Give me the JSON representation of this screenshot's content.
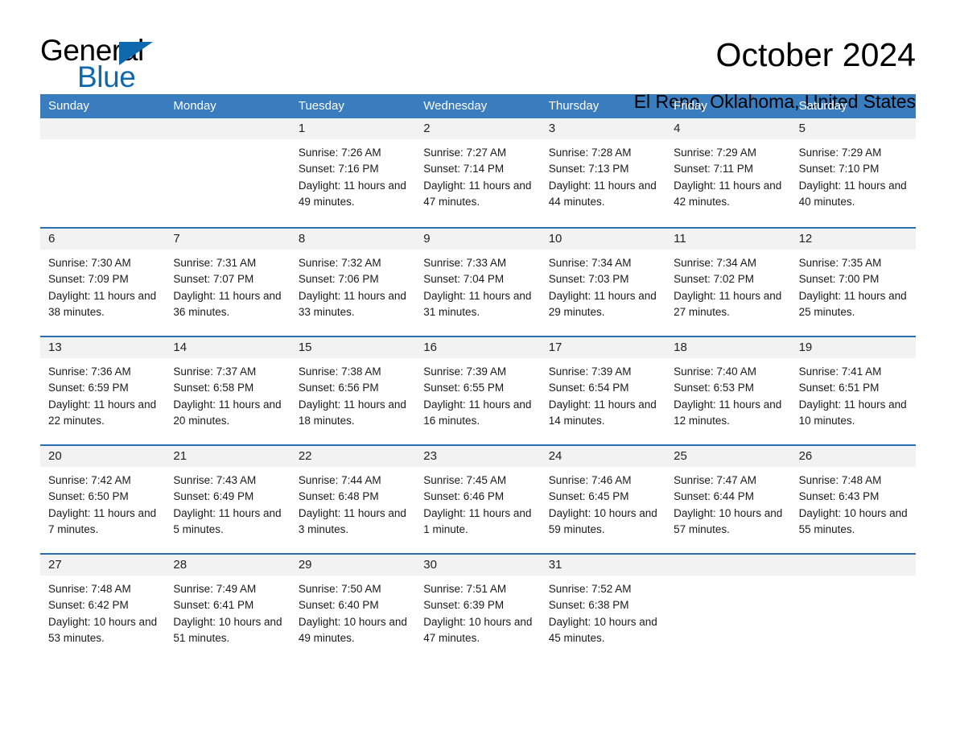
{
  "brand": {
    "word1": "General",
    "word2": "Blue",
    "accent_color": "#1068ad"
  },
  "header": {
    "title": "October 2024",
    "location": "El Reno, Oklahoma, United States"
  },
  "calendar": {
    "header_bg": "#3a7dbf",
    "row_border": "#2a6db3",
    "daynumber_bg": "#f2f2f2",
    "weekdays": [
      "Sunday",
      "Monday",
      "Tuesday",
      "Wednesday",
      "Thursday",
      "Friday",
      "Saturday"
    ],
    "weeks": [
      [
        {
          "day": "",
          "info": ""
        },
        {
          "day": "",
          "info": ""
        },
        {
          "day": "1",
          "info": "Sunrise: 7:26 AM\nSunset: 7:16 PM\nDaylight: 11 hours and 49 minutes."
        },
        {
          "day": "2",
          "info": "Sunrise: 7:27 AM\nSunset: 7:14 PM\nDaylight: 11 hours and 47 minutes."
        },
        {
          "day": "3",
          "info": "Sunrise: 7:28 AM\nSunset: 7:13 PM\nDaylight: 11 hours and 44 minutes."
        },
        {
          "day": "4",
          "info": "Sunrise: 7:29 AM\nSunset: 7:11 PM\nDaylight: 11 hours and 42 minutes."
        },
        {
          "day": "5",
          "info": "Sunrise: 7:29 AM\nSunset: 7:10 PM\nDaylight: 11 hours and 40 minutes."
        }
      ],
      [
        {
          "day": "6",
          "info": "Sunrise: 7:30 AM\nSunset: 7:09 PM\nDaylight: 11 hours and 38 minutes."
        },
        {
          "day": "7",
          "info": "Sunrise: 7:31 AM\nSunset: 7:07 PM\nDaylight: 11 hours and 36 minutes."
        },
        {
          "day": "8",
          "info": "Sunrise: 7:32 AM\nSunset: 7:06 PM\nDaylight: 11 hours and 33 minutes."
        },
        {
          "day": "9",
          "info": "Sunrise: 7:33 AM\nSunset: 7:04 PM\nDaylight: 11 hours and 31 minutes."
        },
        {
          "day": "10",
          "info": "Sunrise: 7:34 AM\nSunset: 7:03 PM\nDaylight: 11 hours and 29 minutes."
        },
        {
          "day": "11",
          "info": "Sunrise: 7:34 AM\nSunset: 7:02 PM\nDaylight: 11 hours and 27 minutes."
        },
        {
          "day": "12",
          "info": "Sunrise: 7:35 AM\nSunset: 7:00 PM\nDaylight: 11 hours and 25 minutes."
        }
      ],
      [
        {
          "day": "13",
          "info": "Sunrise: 7:36 AM\nSunset: 6:59 PM\nDaylight: 11 hours and 22 minutes."
        },
        {
          "day": "14",
          "info": "Sunrise: 7:37 AM\nSunset: 6:58 PM\nDaylight: 11 hours and 20 minutes."
        },
        {
          "day": "15",
          "info": "Sunrise: 7:38 AM\nSunset: 6:56 PM\nDaylight: 11 hours and 18 minutes."
        },
        {
          "day": "16",
          "info": "Sunrise: 7:39 AM\nSunset: 6:55 PM\nDaylight: 11 hours and 16 minutes."
        },
        {
          "day": "17",
          "info": "Sunrise: 7:39 AM\nSunset: 6:54 PM\nDaylight: 11 hours and 14 minutes."
        },
        {
          "day": "18",
          "info": "Sunrise: 7:40 AM\nSunset: 6:53 PM\nDaylight: 11 hours and 12 minutes."
        },
        {
          "day": "19",
          "info": "Sunrise: 7:41 AM\nSunset: 6:51 PM\nDaylight: 11 hours and 10 minutes."
        }
      ],
      [
        {
          "day": "20",
          "info": "Sunrise: 7:42 AM\nSunset: 6:50 PM\nDaylight: 11 hours and 7 minutes."
        },
        {
          "day": "21",
          "info": "Sunrise: 7:43 AM\nSunset: 6:49 PM\nDaylight: 11 hours and 5 minutes."
        },
        {
          "day": "22",
          "info": "Sunrise: 7:44 AM\nSunset: 6:48 PM\nDaylight: 11 hours and 3 minutes."
        },
        {
          "day": "23",
          "info": "Sunrise: 7:45 AM\nSunset: 6:46 PM\nDaylight: 11 hours and 1 minute."
        },
        {
          "day": "24",
          "info": "Sunrise: 7:46 AM\nSunset: 6:45 PM\nDaylight: 10 hours and 59 minutes."
        },
        {
          "day": "25",
          "info": "Sunrise: 7:47 AM\nSunset: 6:44 PM\nDaylight: 10 hours and 57 minutes."
        },
        {
          "day": "26",
          "info": "Sunrise: 7:48 AM\nSunset: 6:43 PM\nDaylight: 10 hours and 55 minutes."
        }
      ],
      [
        {
          "day": "27",
          "info": "Sunrise: 7:48 AM\nSunset: 6:42 PM\nDaylight: 10 hours and 53 minutes."
        },
        {
          "day": "28",
          "info": "Sunrise: 7:49 AM\nSunset: 6:41 PM\nDaylight: 10 hours and 51 minutes."
        },
        {
          "day": "29",
          "info": "Sunrise: 7:50 AM\nSunset: 6:40 PM\nDaylight: 10 hours and 49 minutes."
        },
        {
          "day": "30",
          "info": "Sunrise: 7:51 AM\nSunset: 6:39 PM\nDaylight: 10 hours and 47 minutes."
        },
        {
          "day": "31",
          "info": "Sunrise: 7:52 AM\nSunset: 6:38 PM\nDaylight: 10 hours and 45 minutes."
        },
        {
          "day": "",
          "info": ""
        },
        {
          "day": "",
          "info": ""
        }
      ]
    ]
  }
}
